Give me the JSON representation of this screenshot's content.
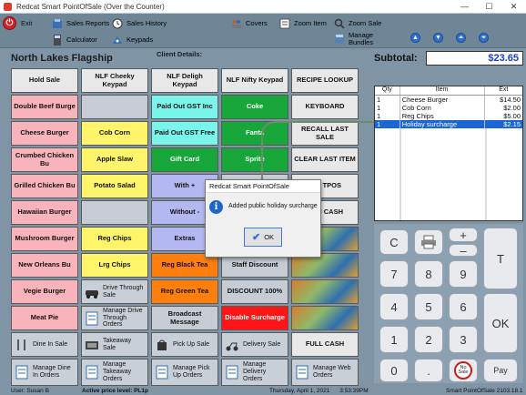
{
  "window": {
    "title": "Redcat Smart PointOfSale (Over the Counter)",
    "minimize": "—",
    "maximize": "☐",
    "close": "✕"
  },
  "toolbar": {
    "exit": "Exit",
    "sales_reports": "Sales Reports",
    "sales_history": "Sales History",
    "calculator": "Calculator",
    "keypads": "Keypads",
    "covers": "Covers",
    "zoom_item": "Zoom Item",
    "zoom_sale": "Zoom Sale",
    "manage_bundles": "Manage Bundles"
  },
  "store_name": "North Lakes Flagship",
  "client_details": "Client Details:",
  "buttons": [
    [
      "Hold Sale",
      "NLF Cheeky Keypad",
      "NLF Deligh Keypad",
      "NLF Nifty Keypad",
      "RECIPE LOOKUP"
    ],
    [
      "Double Beef Burge",
      "",
      "Paid Out GST Inc",
      "Coke",
      "KEYBOARD"
    ],
    [
      "Cheese Burger",
      "Cob Corn",
      "Paid Out GST Free",
      "Fanta",
      "RECALL LAST SALE"
    ],
    [
      "Crumbed Chicken Bu",
      "Apple Slaw",
      "Gift Card",
      "Sprite",
      "CLEAR LAST ITEM"
    ],
    [
      "Grilled Chicken Bu",
      "Potato Salad",
      "With +",
      "",
      "TPOS"
    ],
    [
      "Hawaiian Burger",
      "",
      "Without -",
      "",
      "N CASH"
    ],
    [
      "Mushroom Burger",
      "Reg Chips",
      "Extras",
      "",
      ""
    ],
    [
      "New Orleans Bu",
      "Lrg Chips",
      "Reg Black Tea",
      "Staff Discount",
      ""
    ],
    [
      "Vegie Burger",
      "Drive Through Sale",
      "Reg Green Tea",
      "DISCOUNT 100%",
      ""
    ],
    [
      "Meat Pie",
      "Manage Drive Through Orders",
      "Broadcast Message",
      "Disable Surcharge",
      ""
    ],
    [
      "Dine In Sale",
      "Takeaway Sale",
      "Pick Up Sale",
      "Delivery Sale",
      "FULL CASH"
    ],
    [
      "Manage Dine In Orders",
      "Manage Takeaway Orders",
      "Manage Pick Up Orders",
      "Manage Delivery Orders",
      "Manage Web Orders"
    ]
  ],
  "subtotal": {
    "label": "Subtotal:",
    "value": "$23.65"
  },
  "order": {
    "headers": [
      "Qty",
      "Item",
      "Ext"
    ],
    "rows": [
      {
        "qty": "1",
        "item": "Cheese Burger",
        "ext": "$14.50"
      },
      {
        "qty": "1",
        "item": "Cob Corn",
        "ext": "$2.00"
      },
      {
        "qty": "1",
        "item": "Reg Chips",
        "ext": "$5.00"
      },
      {
        "qty": "1",
        "item": "Holiday surcharge",
        "ext": "$2.15"
      }
    ]
  },
  "keypad": {
    "c": "C",
    "plus": "+",
    "minus": "–",
    "t": "T",
    "ok": "OK",
    "d7": "7",
    "d8": "8",
    "d9": "9",
    "d4": "4",
    "d5": "5",
    "d6": "6",
    "d1": "1",
    "d2": "2",
    "d3": "3",
    "d0": "0",
    "dot": ".",
    "nosale_1": "No",
    "nosale_2": "Sale",
    "pay": "Pay"
  },
  "status": {
    "user": "User: Susan B",
    "price_level": "Active price level: PL1p",
    "datetime": "Thursday, April 1, 2021      3:53:39PM",
    "version": "Smart PointOfSale 2103.18.1"
  },
  "dialog": {
    "title": "Redcat Smart PointOfSale",
    "message": "Added public holiday surcharge",
    "ok": "OK"
  },
  "colors": {
    "subtotal_text": "#1a3fc2",
    "selected_row": "#1a66d8",
    "callout_line": "#6e8b6a"
  }
}
